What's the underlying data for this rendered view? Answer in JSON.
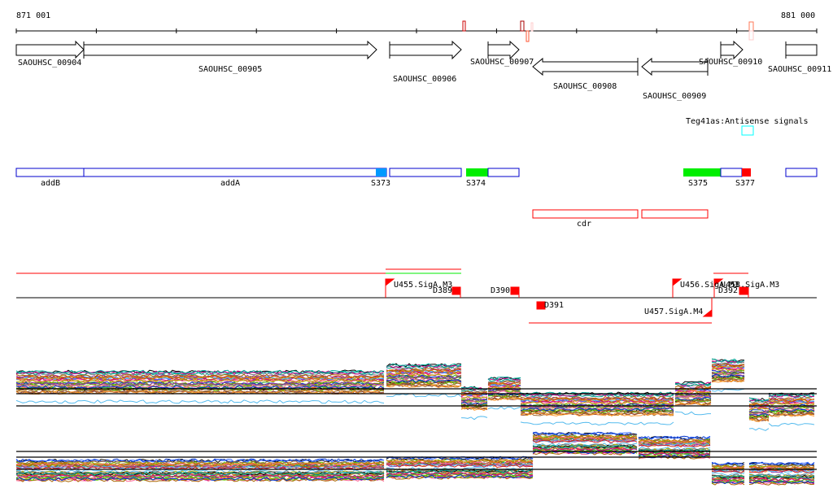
{
  "ruler": {
    "start_label": "871 001",
    "end_label": "881 000"
  },
  "genes": [
    {
      "id": "SAOUHSC_00904",
      "strand": "+"
    },
    {
      "id": "SAOUHSC_00905",
      "strand": "+"
    },
    {
      "id": "SAOUHSC_00906",
      "strand": "+"
    },
    {
      "id": "SAOUHSC_00907",
      "strand": "+"
    },
    {
      "id": "SAOUHSC_00908",
      "strand": "-"
    },
    {
      "id": "SAOUHSC_00909",
      "strand": "-"
    },
    {
      "id": "SAOUHSC_00910",
      "strand": "+"
    },
    {
      "id": "SAOUHSC_00911",
      "strand": "+"
    }
  ],
  "antisense": {
    "label": "Teg41as:Antisense signals",
    "color": "#00ffff"
  },
  "segments": {
    "labels": [
      "addB",
      "addA",
      "S373",
      "S374",
      "S375",
      "S377"
    ],
    "colors": {
      "outline": "#0000cc",
      "S373": "#0099ff",
      "S374": "#00ee00",
      "S375": "#00ee00",
      "S377": "#ff0000"
    }
  },
  "regulatory": {
    "label": "cdr",
    "color": "#ff0000"
  },
  "signals": {
    "labels": [
      "U455.SigA.M3",
      "D389",
      "D390",
      "D391",
      "U456.SigA.M3",
      "U458.SigA.M3",
      "D392",
      "U457.SigA.M4"
    ]
  },
  "expression": {
    "panels": [
      {
        "profile": [
          [
            20,
            475,
            470
          ],
          [
            475,
            567,
            462
          ],
          [
            567,
            600,
            490
          ],
          [
            600,
            640,
            478
          ],
          [
            640,
            830,
            497
          ],
          [
            830,
            875,
            484
          ],
          [
            875,
            918,
            456
          ],
          [
            918,
            921,
            null
          ],
          [
            921,
            945,
            504
          ],
          [
            945,
            1004,
            498
          ]
        ],
        "hlines": [
          478,
          484,
          499
        ]
      },
      {
        "profile": [
          [
            20,
            475,
            578
          ],
          [
            475,
            655,
            575
          ],
          [
            655,
            785,
            545
          ],
          [
            785,
            875,
            550
          ],
          [
            875,
            918,
            582
          ],
          [
            918,
            921,
            null
          ],
          [
            921,
            1004,
            582
          ]
        ],
        "hlines": [
          555,
          562,
          577
        ]
      }
    ],
    "colors": [
      "#000000",
      "#e06020",
      "#888800",
      "#33aa33",
      "#9933aa",
      "#55bbee",
      "#cc2222",
      "#aa6600",
      "#66cc00",
      "#777777",
      "#ff6699",
      "#996633",
      "#0033cc",
      "#dd8800",
      "#cc0088",
      "#00aa99",
      "#aaaa00",
      "#884444",
      "#ff9933",
      "#3366ff"
    ]
  }
}
